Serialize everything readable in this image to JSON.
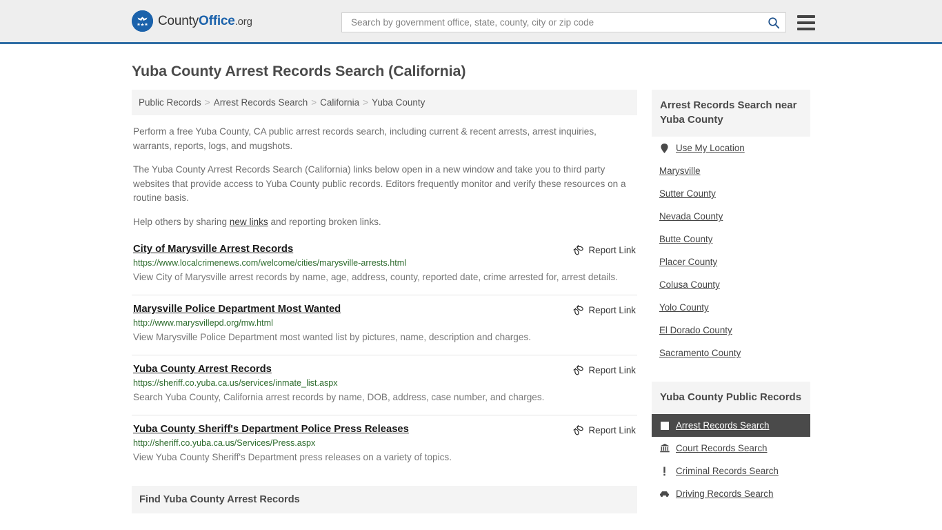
{
  "header": {
    "logo": {
      "part1": "County",
      "part2": "Office",
      "part3": ".org",
      "icon": "eagle-emblem-icon"
    },
    "search": {
      "placeholder": "Search by government office, state, county, city or zip code",
      "value": "",
      "search_icon": "search-icon"
    },
    "menu_icon": "hamburger-menu-icon",
    "accent_color": "#2e6da4",
    "background_color": "#eeeeee"
  },
  "page_title": "Yuba County Arrest Records Search (California)",
  "breadcrumb": {
    "separator": ">",
    "items": [
      {
        "label": "Public Records"
      },
      {
        "label": "Arrest Records Search"
      },
      {
        "label": "California"
      },
      {
        "label": "Yuba County"
      }
    ]
  },
  "intro": {
    "paragraph1": "Perform a free Yuba County, CA public arrest records search, including current & recent arrests, arrest inquiries, warrants, reports, logs, and mugshots.",
    "paragraph2": "The Yuba County Arrest Records Search (California) links below open in a new window and take you to third party websites that provide access to Yuba County public records. Editors frequently monitor and verify these resources on a routine basis.",
    "paragraph3_before": "Help others by sharing ",
    "paragraph3_link": "new links",
    "paragraph3_after": " and reporting broken links."
  },
  "report_link_label": "Report Link",
  "report_link_icon": "broken-link-icon",
  "results": [
    {
      "title": "City of Marysville Arrest Records",
      "url": "https://www.localcrimenews.com/welcome/cities/marysville-arrests.html",
      "description": "View City of Marysville arrest records by name, age, address, county, reported date, crime arrested for, arrest details."
    },
    {
      "title": "Marysville Police Department Most Wanted",
      "url": "http://www.marysvillepd.org/mw.html",
      "description": "View Marysville Police Department most wanted list by pictures, name, description and charges."
    },
    {
      "title": "Yuba County Arrest Records",
      "url": "https://sheriff.co.yuba.ca.us/services/inmate_list.aspx",
      "description": "Search Yuba County, California arrest records by name, DOB, address, case number, and charges."
    },
    {
      "title": "Yuba County Sheriff's Department Police Press Releases",
      "url": "http://sheriff.co.yuba.ca.us/Services/Press.aspx",
      "description": "View Yuba County Sheriff's Department press releases on a variety of topics."
    }
  ],
  "find_section": {
    "title": "Find Yuba County Arrest Records"
  },
  "sidebar": {
    "nearby": {
      "heading": "Arrest Records Search near Yuba County",
      "items": [
        {
          "label": "Use My Location",
          "icon": "map-pin-icon"
        },
        {
          "label": "Marysville",
          "icon": ""
        },
        {
          "label": "Sutter County",
          "icon": ""
        },
        {
          "label": "Nevada County",
          "icon": ""
        },
        {
          "label": "Butte County",
          "icon": ""
        },
        {
          "label": "Placer County",
          "icon": ""
        },
        {
          "label": "Colusa County",
          "icon": ""
        },
        {
          "label": "Yolo County",
          "icon": ""
        },
        {
          "label": "El Dorado County",
          "icon": ""
        },
        {
          "label": "Sacramento County",
          "icon": ""
        }
      ]
    },
    "public_records": {
      "heading": "Yuba County Public Records",
      "items": [
        {
          "label": "Arrest Records Search",
          "icon": "fingerprint-card-icon",
          "active": true
        },
        {
          "label": "Court Records Search",
          "icon": "courthouse-icon",
          "active": false
        },
        {
          "label": "Criminal Records Search",
          "icon": "exclamation-icon",
          "active": false
        },
        {
          "label": "Driving Records Search",
          "icon": "car-icon",
          "active": false
        }
      ]
    },
    "active_background": "#4a4a4a"
  }
}
